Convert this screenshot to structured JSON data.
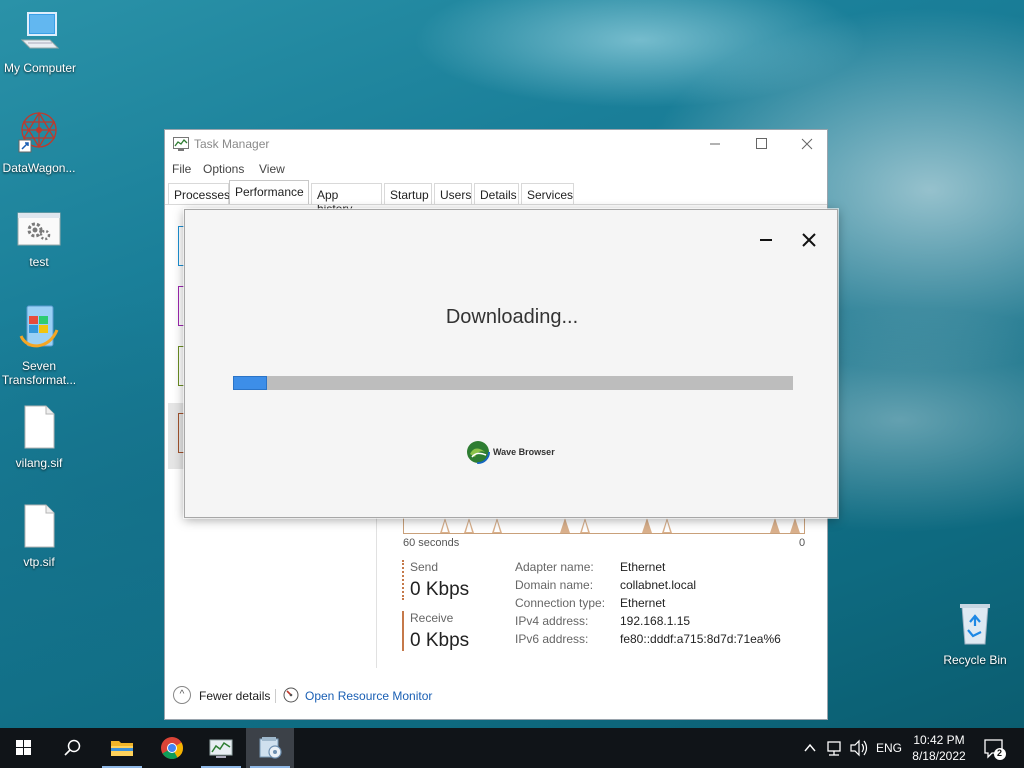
{
  "desktop": {
    "icons": [
      {
        "label": "My Computer",
        "icon": "computer-icon"
      },
      {
        "label": "DataWagon...",
        "icon": "datawagon-icon"
      },
      {
        "label": "test",
        "icon": "settings-file-icon"
      },
      {
        "label": "Seven\nTransformat...",
        "icon": "seven-transformation-icon"
      },
      {
        "label": "vilang.sif",
        "icon": "blank-file-icon"
      },
      {
        "label": "vtp.sif",
        "icon": "blank-file-icon"
      }
    ],
    "recycle_bin": {
      "label": "Recycle Bin",
      "icon": "recycle-bin-icon"
    }
  },
  "task_manager": {
    "title": "Task Manager",
    "menu": [
      "File",
      "Options",
      "View"
    ],
    "tabs": [
      "Processes",
      "Performance",
      "App history",
      "Startup",
      "Users",
      "Details",
      "Services"
    ],
    "active_tab": "Performance",
    "graph": {
      "left_label": "60 seconds",
      "right_label": "0"
    },
    "send": {
      "label": "Send",
      "value": "0 Kbps"
    },
    "receive": {
      "label": "Receive",
      "value": "0 Kbps"
    },
    "details": [
      {
        "key": "Adapter name:",
        "value": "Ethernet"
      },
      {
        "key": "Domain name:",
        "value": "collabnet.local"
      },
      {
        "key": "Connection type:",
        "value": "Ethernet"
      },
      {
        "key": "IPv4 address:",
        "value": "192.168.1.15"
      },
      {
        "key": "IPv6 address:",
        "value": "fe80::dddf:a715:8d7d:71ea%6"
      }
    ],
    "footer": {
      "fewer_details": "Fewer details",
      "resource_monitor": "Open Resource Monitor"
    }
  },
  "download_dialog": {
    "title": "Downloading...",
    "progress_fraction": 0.06,
    "brand": "Wave Browser",
    "colors": {
      "progress_fill": "#3d8ee8",
      "progress_track": "#bdbdbd"
    }
  },
  "taskbar": {
    "apps": [
      "start-icon",
      "search-icon",
      "file-explorer-icon",
      "chrome-icon",
      "task-manager-icon",
      "setup-installer-icon"
    ],
    "active_app": "setup-installer-icon",
    "tray": {
      "language": "ENG",
      "time": "10:42 PM",
      "date": "8/18/2022",
      "notification_count": "2"
    }
  }
}
